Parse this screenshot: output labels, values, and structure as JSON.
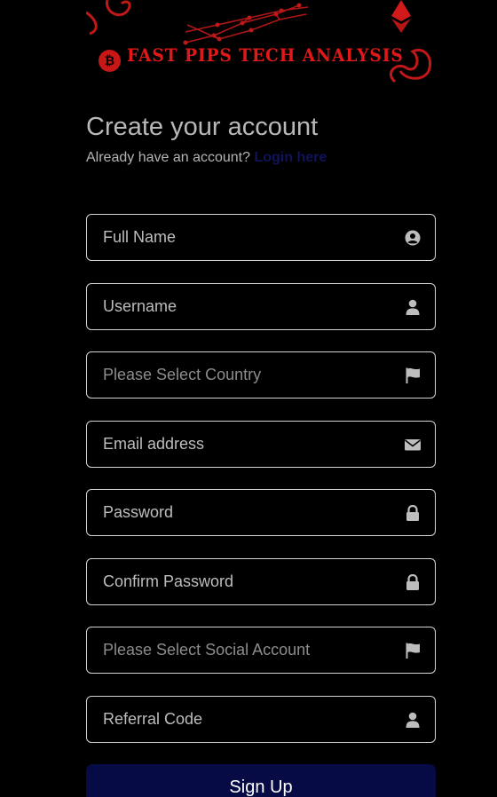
{
  "brand": {
    "title": "FAST PIPS TECH ANALYSIS",
    "coin_symbol": "₿",
    "accent_color": "#e01818"
  },
  "heading": "Create your account",
  "login_prompt": {
    "text": "Already have an account?",
    "link": "Login here"
  },
  "fields": [
    {
      "label": "Full Name",
      "type": "input",
      "icon": "user-circle-icon"
    },
    {
      "label": "Username",
      "type": "input",
      "icon": "user-icon"
    },
    {
      "label": "Please Select Country",
      "type": "select",
      "icon": "flag-icon"
    },
    {
      "label": "Email address",
      "type": "input",
      "icon": "envelope-icon"
    },
    {
      "label": "Password",
      "type": "input",
      "icon": "lock-icon"
    },
    {
      "label": "Confirm Password",
      "type": "input",
      "icon": "lock-icon"
    },
    {
      "label": "Please Select Social Account",
      "type": "select",
      "icon": "flag-icon"
    },
    {
      "label": "Referral Code",
      "type": "input",
      "icon": "user-icon"
    }
  ],
  "submit_label": "Sign Up",
  "colors": {
    "background": "#000000",
    "button": "#060a45",
    "link": "#10135a",
    "field_border": "#d6d6d6"
  }
}
